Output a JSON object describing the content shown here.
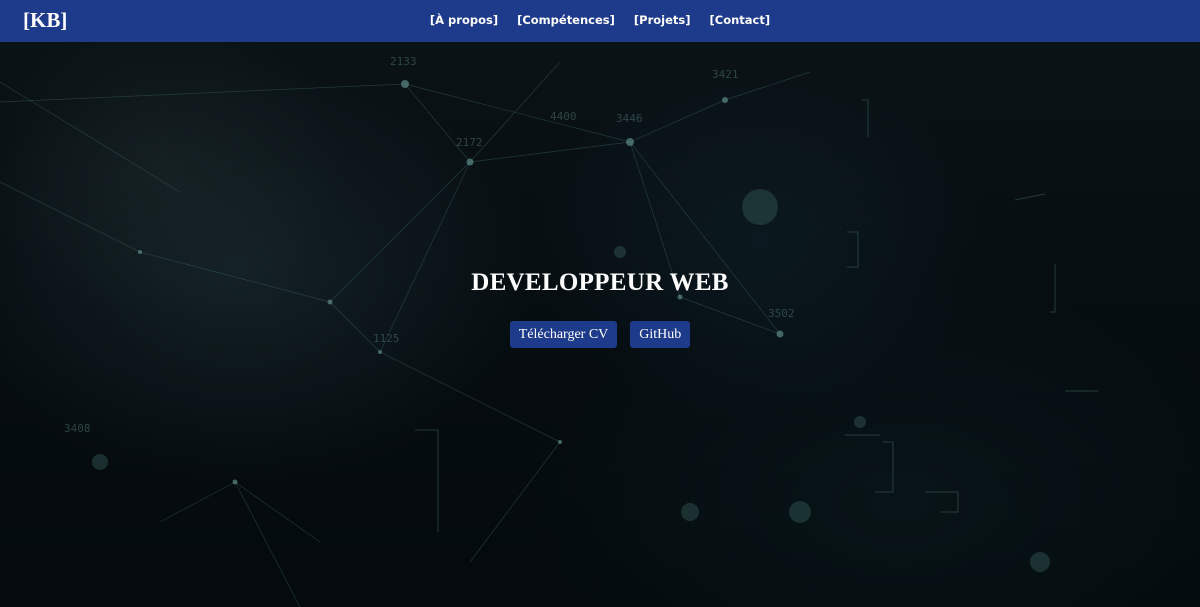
{
  "navbar": {
    "brand": "[KB]",
    "links": [
      {
        "label": "[À propos]"
      },
      {
        "label": "[Compétences]"
      },
      {
        "label": "[Projets]"
      },
      {
        "label": "[Contact]"
      }
    ]
  },
  "hero": {
    "title": "DEVELOPPEUR WEB",
    "buttons": {
      "cv": "Télécharger CV",
      "github": "GitHub"
    },
    "background_numbers": [
      "2133",
      "3421",
      "4400",
      "3446",
      "2172",
      "3502",
      "1125",
      "3408"
    ]
  },
  "colors": {
    "navbar": "#1e3a8a",
    "button": "#1e3a8a",
    "text": "#ffffff",
    "background": "#05090c"
  }
}
